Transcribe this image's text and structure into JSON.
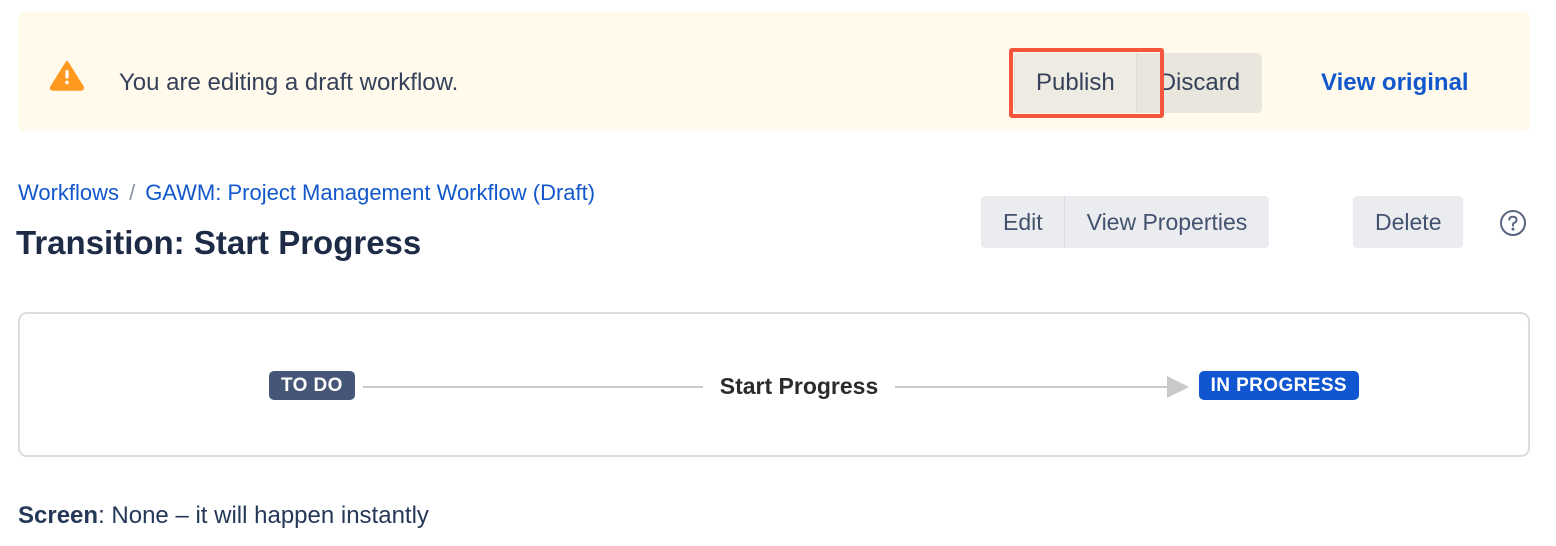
{
  "banner": {
    "icon": "warning-triangle-icon",
    "message": "You are editing a draft workflow.",
    "publish_label": "Publish",
    "discard_label": "Discard",
    "view_original_label": "View original",
    "background_color": "#FFFAEB",
    "icon_color": "#FF991F",
    "highlight_color": "#F4553C"
  },
  "breadcrumb": {
    "root_label": "Workflows",
    "separator": "/",
    "current_label": "GAWM: Project Management Workflow (Draft)",
    "link_color": "#1257CC"
  },
  "header": {
    "title": "Transition: Start Progress",
    "edit_label": "Edit",
    "view_properties_label": "View Properties",
    "delete_label": "Delete",
    "help_icon": "help-circle-icon"
  },
  "transition": {
    "from_status": "TO DO",
    "from_status_color": "#455676",
    "name": "Start Progress",
    "to_status": "IN PROGRESS",
    "to_status_color": "#1056D0",
    "connector_color": "#C9C9C9"
  },
  "details": {
    "screen_label": "Screen",
    "screen_value": ": None – it will happen instantly"
  }
}
